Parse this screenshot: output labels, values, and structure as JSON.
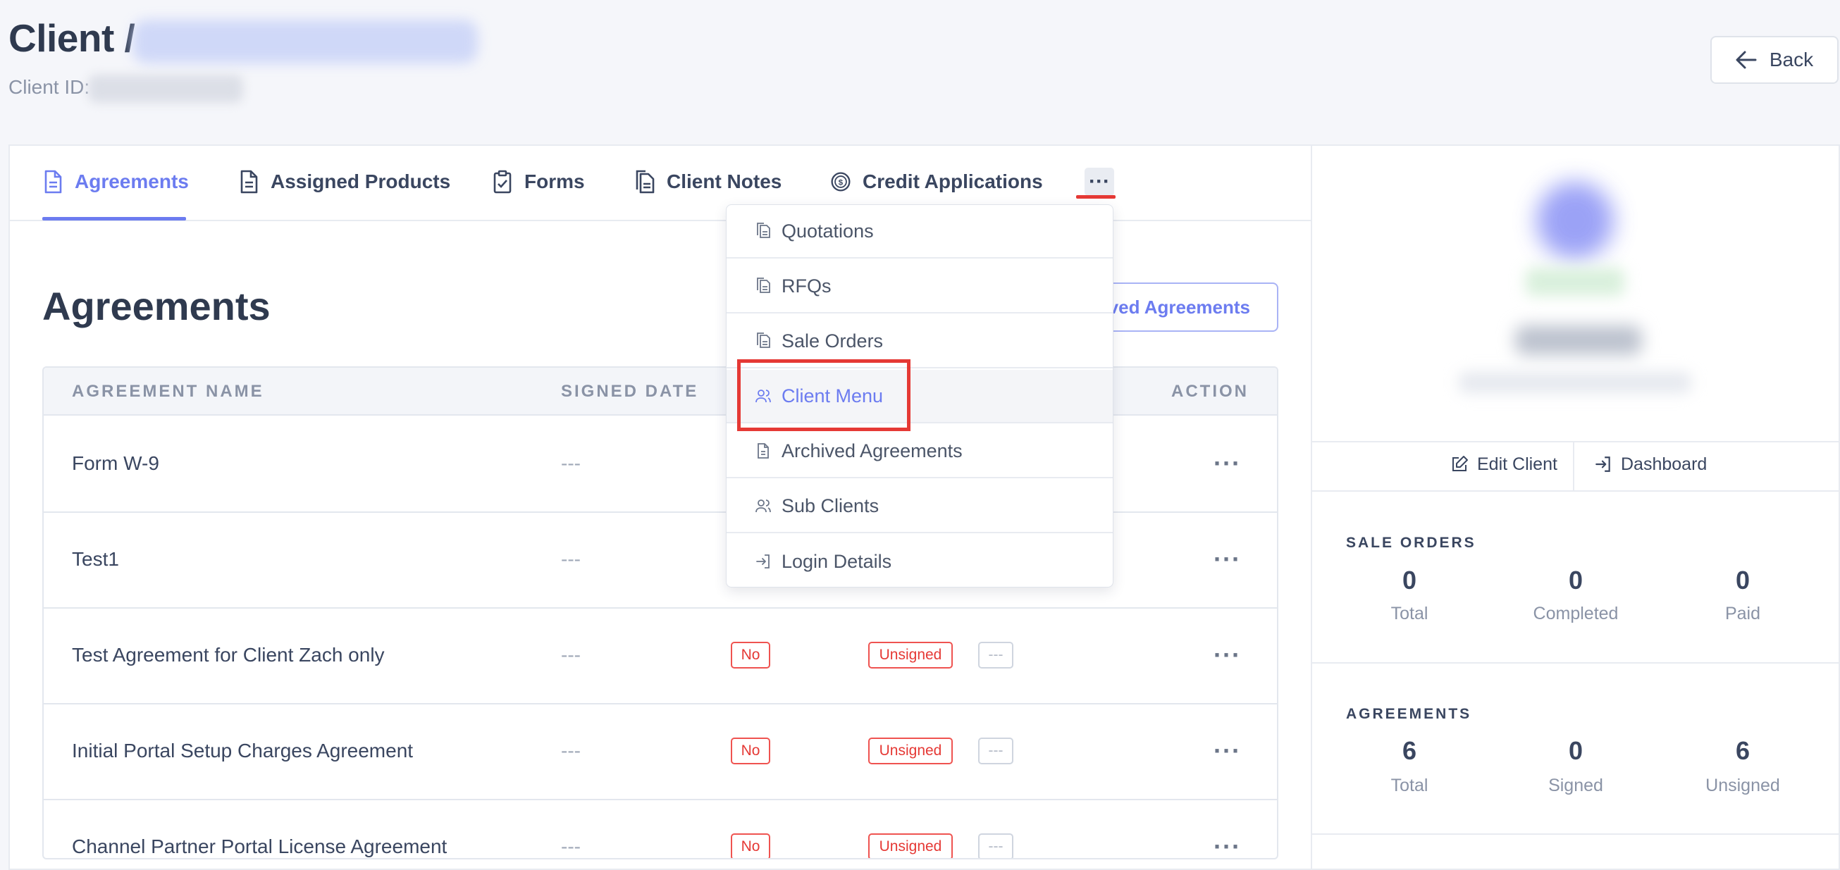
{
  "header": {
    "title": "Client /",
    "client_id_label": "Client ID:",
    "back_label": "Back"
  },
  "tabs": [
    {
      "label": "Agreements",
      "icon": "document-icon",
      "active": true
    },
    {
      "label": "Assigned Products",
      "icon": "document-icon",
      "active": false
    },
    {
      "label": "Forms",
      "icon": "clipboard-check-icon",
      "active": false
    },
    {
      "label": "Client Notes",
      "icon": "documents-icon",
      "active": false
    },
    {
      "label": "Credit Applications",
      "icon": "dollar-coin-icon",
      "active": false
    }
  ],
  "more_label": "···",
  "section": {
    "title": "Agreements",
    "archived_button": "ved Agreements"
  },
  "table": {
    "columns": [
      "AGREEMENT NAME",
      "SIGNED DATE",
      "ACTION"
    ],
    "rows": [
      {
        "name": "Form W-9",
        "signed_date": "---",
        "required": "",
        "status": "",
        "extra": ""
      },
      {
        "name": "Test1",
        "signed_date": "---",
        "required": "",
        "status": "",
        "extra": ""
      },
      {
        "name": "Test Agreement for Client Zach only",
        "signed_date": "---",
        "required": "No",
        "status": "Unsigned",
        "extra": "---"
      },
      {
        "name": "Initial Portal Setup Charges Agreement",
        "signed_date": "---",
        "required": "No",
        "status": "Unsigned",
        "extra": "---"
      },
      {
        "name": "Channel Partner Portal License Agreement",
        "signed_date": "---",
        "required": "No",
        "status": "Unsigned",
        "extra": "---"
      }
    ],
    "action_label": "···"
  },
  "dropdown": {
    "items": [
      {
        "label": "Quotations",
        "icon": "copy-document-icon"
      },
      {
        "label": "RFQs",
        "icon": "copy-document-icon"
      },
      {
        "label": "Sale Orders",
        "icon": "copy-document-icon"
      },
      {
        "label": "Client Menu",
        "icon": "users-icon",
        "highlighted": true
      },
      {
        "label": "Archived Agreements",
        "icon": "document-icon"
      },
      {
        "label": "Sub Clients",
        "icon": "users-icon"
      },
      {
        "label": "Login Details",
        "icon": "login-icon"
      }
    ]
  },
  "side": {
    "edit_client": "Edit Client",
    "dashboard": "Dashboard",
    "sale_orders": {
      "title": "SALE ORDERS",
      "stats": [
        {
          "value": "0",
          "label": "Total"
        },
        {
          "value": "0",
          "label": "Completed"
        },
        {
          "value": "0",
          "label": "Paid"
        }
      ]
    },
    "agreements": {
      "title": "AGREEMENTS",
      "stats": [
        {
          "value": "6",
          "label": "Total"
        },
        {
          "value": "0",
          "label": "Signed"
        },
        {
          "value": "6",
          "label": "Unsigned"
        }
      ]
    }
  },
  "colors": {
    "accent": "#6c7cf0",
    "danger": "#e53935",
    "text": "#3a4660",
    "muted": "#8a93a6"
  }
}
